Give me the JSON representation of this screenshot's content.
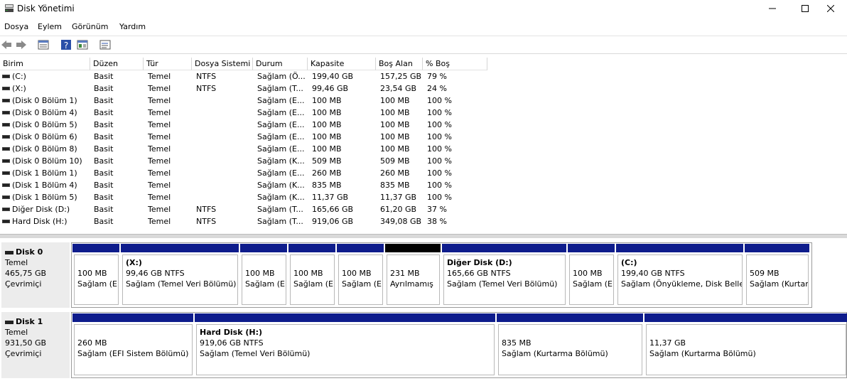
{
  "window": {
    "title": "Disk Yönetimi",
    "minimize": "—",
    "maximize": "☐",
    "close": "✕"
  },
  "menu": [
    "Dosya",
    "Eylem",
    "Görünüm",
    "Yardım"
  ],
  "toolbar_icons": [
    "back-arrow-icon",
    "forward-arrow-icon",
    "disk-list-icon",
    "help-icon",
    "properties-icon",
    "settings-icon"
  ],
  "columns": [
    "Birim",
    "Düzen",
    "Tür",
    "Dosya Sistemi",
    "Durum",
    "Kapasite",
    "Boş Alan",
    "% Boş"
  ],
  "rows": [
    [
      "(C:)",
      "Basit",
      "Temel",
      "NTFS",
      "Sağlam (Ö...",
      "199,40 GB",
      "157,25 GB",
      "79 %"
    ],
    [
      "(X:)",
      "Basit",
      "Temel",
      "NTFS",
      "Sağlam (T...",
      "99,46 GB",
      "23,54 GB",
      "24 %"
    ],
    [
      "(Disk 0 Bölüm 1)",
      "Basit",
      "Temel",
      "",
      "Sağlam (E...",
      "100 MB",
      "100 MB",
      "100 %"
    ],
    [
      "(Disk 0 Bölüm 4)",
      "Basit",
      "Temel",
      "",
      "Sağlam (E...",
      "100 MB",
      "100 MB",
      "100 %"
    ],
    [
      "(Disk 0 Bölüm 5)",
      "Basit",
      "Temel",
      "",
      "Sağlam (E...",
      "100 MB",
      "100 MB",
      "100 %"
    ],
    [
      "(Disk 0 Bölüm 6)",
      "Basit",
      "Temel",
      "",
      "Sağlam (E...",
      "100 MB",
      "100 MB",
      "100 %"
    ],
    [
      "(Disk 0 Bölüm 8)",
      "Basit",
      "Temel",
      "",
      "Sağlam (E...",
      "100 MB",
      "100 MB",
      "100 %"
    ],
    [
      "(Disk 0 Bölüm 10)",
      "Basit",
      "Temel",
      "",
      "Sağlam (K...",
      "509 MB",
      "509 MB",
      "100 %"
    ],
    [
      "(Disk 1 Bölüm 1)",
      "Basit",
      "Temel",
      "",
      "Sağlam (E...",
      "260 MB",
      "260 MB",
      "100 %"
    ],
    [
      "(Disk 1 Bölüm 4)",
      "Basit",
      "Temel",
      "",
      "Sağlam (K...",
      "835 MB",
      "835 MB",
      "100 %"
    ],
    [
      "(Disk 1 Bölüm 5)",
      "Basit",
      "Temel",
      "",
      "Sağlam (K...",
      "11,37 GB",
      "11,37 GB",
      "100 %"
    ],
    [
      "Diğer Disk (D:)",
      "Basit",
      "Temel",
      "NTFS",
      "Sağlam (T...",
      "165,66 GB",
      "61,20 GB",
      "37 %"
    ],
    [
      "Hard Disk (H:)",
      "Basit",
      "Temel",
      "NTFS",
      "Sağlam (T...",
      "919,06 GB",
      "349,08 GB",
      "38 %"
    ]
  ],
  "disks": [
    {
      "name": "Disk 0",
      "type": "Temel",
      "size": "465,75 GB",
      "status": "Çevrimiçi",
      "partitions": [
        {
          "name": "",
          "line1": "100 MB",
          "line2": "Sağlam (E",
          "bar": "blue"
        },
        {
          "name": "(X:)",
          "line1": "99,46 GB NTFS",
          "line2": "Sağlam (Temel Veri Bölümü)",
          "bar": "blue"
        },
        {
          "name": "",
          "line1": "100 MB",
          "line2": "Sağlam (E",
          "bar": "blue"
        },
        {
          "name": "",
          "line1": "100 MB",
          "line2": "Sağlam (E",
          "bar": "blue"
        },
        {
          "name": "",
          "line1": "100 MB",
          "line2": "Sağlam (E",
          "bar": "blue"
        },
        {
          "name": "",
          "line1": "231 MB",
          "line2": "Ayrılmamış",
          "bar": "black"
        },
        {
          "name": "Diğer Disk  (D:)",
          "line1": "165,66 GB NTFS",
          "line2": "Sağlam (Temel Veri Bölümü)",
          "bar": "blue"
        },
        {
          "name": "",
          "line1": "100 MB",
          "line2": "Sağlam (E",
          "bar": "blue"
        },
        {
          "name": "(C:)",
          "line1": "199,40 GB NTFS",
          "line2": "Sağlam (Önyükleme, Disk Belle",
          "bar": "blue"
        },
        {
          "name": "",
          "line1": "509 MB",
          "line2": "Sağlam (Kurtar",
          "bar": "blue"
        }
      ]
    },
    {
      "name": "Disk 1",
      "type": "Temel",
      "size": "931,50 GB",
      "status": "Çevrimiçi",
      "partitions": [
        {
          "name": "",
          "line1": "260 MB",
          "line2": "Sağlam (EFI Sistem Bölümü)",
          "bar": "blue"
        },
        {
          "name": "Hard Disk  (H:)",
          "line1": "919,06 GB NTFS",
          "line2": "Sağlam (Temel Veri Bölümü)",
          "bar": "blue"
        },
        {
          "name": "",
          "line1": "835 MB",
          "line2": "Sağlam (Kurtarma Bölümü)",
          "bar": "blue"
        },
        {
          "name": "",
          "line1": "11,37 GB",
          "line2": "Sağlam (Kurtarma Bölümü)",
          "bar": "blue"
        }
      ]
    }
  ]
}
